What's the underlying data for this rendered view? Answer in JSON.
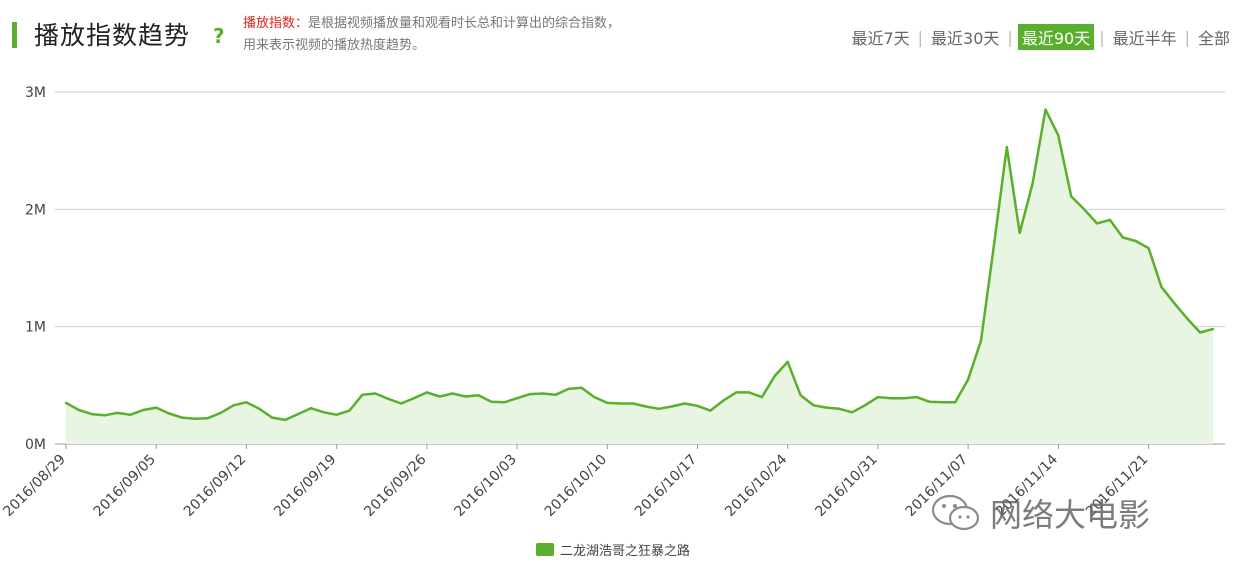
{
  "header": {
    "title": "播放指数趋势",
    "help_icon": "?",
    "desc_key": "播放指数：",
    "desc_text": "是根据视频播放量和观看时长总和计算出的综合指数，用来表示视频的播放热度趋势。"
  },
  "range_options": [
    {
      "label": "最近7天",
      "active": false
    },
    {
      "label": "最近30天",
      "active": false
    },
    {
      "label": "最近90天",
      "active": true
    },
    {
      "label": "最近半年",
      "active": false
    },
    {
      "label": "全部",
      "active": false
    }
  ],
  "legend": {
    "label": "二龙湖浩哥之狂暴之路"
  },
  "watermark": {
    "text": "网络大电影",
    "icon": "wechat-icon"
  },
  "colors": {
    "accent": "#5ab02c",
    "fill": "#e9f5e3",
    "grid": "#cccccc"
  },
  "chart_data": {
    "type": "area",
    "ylim": [
      0,
      3000000
    ],
    "y_ticks": [
      {
        "value": 0,
        "label": "0M"
      },
      {
        "value": 1000000,
        "label": "1M"
      },
      {
        "value": 2000000,
        "label": "2M"
      },
      {
        "value": 3000000,
        "label": "3M"
      }
    ],
    "x_labels": [
      "2016/08/29",
      "2016/09/05",
      "2016/09/12",
      "2016/09/19",
      "2016/09/26",
      "2016/10/03",
      "2016/10/10",
      "2016/10/17",
      "2016/10/24",
      "2016/10/31",
      "2016/11/07",
      "2016/11/14",
      "2016/11/21"
    ],
    "x_start": "2016/08/29",
    "series": [
      {
        "name": "二龙湖浩哥之狂暴之路",
        "values": [
          350000,
          290000,
          255000,
          245000,
          265000,
          250000,
          290000,
          310000,
          260000,
          225000,
          215000,
          220000,
          265000,
          330000,
          355000,
          300000,
          225000,
          205000,
          255000,
          305000,
          270000,
          250000,
          285000,
          420000,
          430000,
          385000,
          345000,
          390000,
          440000,
          405000,
          430000,
          405000,
          415000,
          360000,
          355000,
          390000,
          425000,
          430000,
          420000,
          470000,
          480000,
          400000,
          350000,
          345000,
          345000,
          320000,
          300000,
          320000,
          345000,
          325000,
          285000,
          370000,
          440000,
          440000,
          400000,
          580000,
          700000,
          415000,
          330000,
          310000,
          300000,
          270000,
          330000,
          400000,
          390000,
          390000,
          400000,
          360000,
          355000,
          355000,
          550000,
          880000,
          1690000,
          2530000,
          1800000,
          2220000,
          2850000,
          2630000,
          2110000,
          2000000,
          1880000,
          1910000,
          1760000,
          1730000,
          1670000,
          1340000,
          1200000,
          1070000,
          950000,
          980000
        ]
      }
    ]
  }
}
